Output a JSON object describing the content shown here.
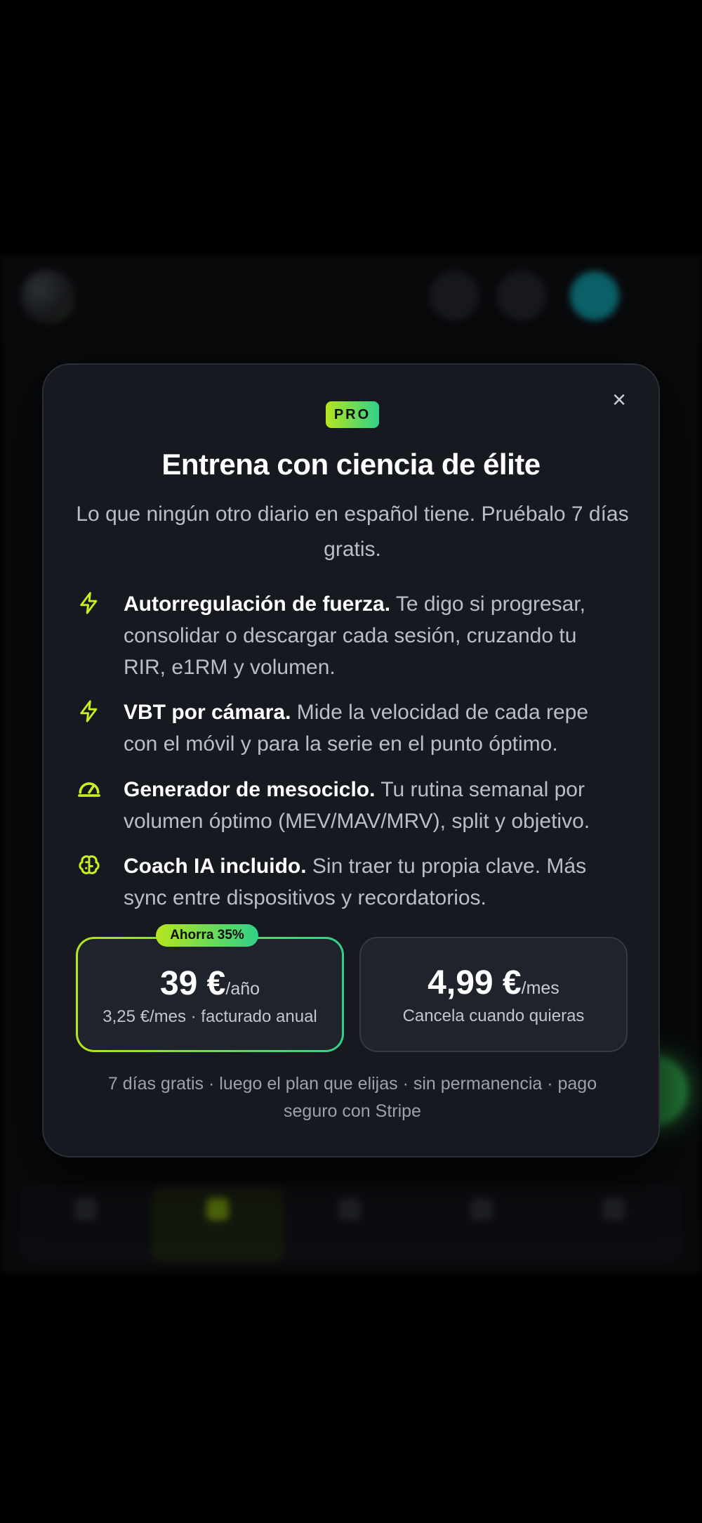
{
  "modal": {
    "badge": "PRO",
    "title": "Entrena con ciencia de élite",
    "subtitle": "Lo que ningún otro diario en español tiene. Pruébalo 7 días gratis.",
    "close_label": "×",
    "features": [
      {
        "icon": "bolt-icon",
        "title": "Autorregulación de fuerza.",
        "text": " Te digo si progresar, consolidar o descargar cada sesión, cruzando tu RIR, e1RM y volumen."
      },
      {
        "icon": "bolt-icon",
        "title": "VBT por cámara.",
        "text": " Mide la velocidad de cada repe con el móvil y para la serie en el punto óptimo."
      },
      {
        "icon": "gauge-icon",
        "title": "Generador de mesociclo.",
        "text": " Tu rutina semanal por volumen óptimo (MEV/MAV/MRV), split y objetivo."
      },
      {
        "icon": "brain-icon",
        "title": "Coach IA incluido.",
        "text": " Sin traer tu propia clave. Más sync entre dispositivos y recordatorios."
      }
    ],
    "plans": {
      "annual": {
        "badge": "Ahorra 35%",
        "price": "39 €",
        "period": "/año",
        "note": "3,25 €/mes · facturado anual"
      },
      "monthly": {
        "price": "4,99 €",
        "period": "/mes",
        "note": "Cancela cuando quieras"
      }
    },
    "footnote": "7 días gratis · luego el plan que elijas · sin permanencia · pago seguro con Stripe"
  },
  "colors": {
    "accent_start": "#b5e51d",
    "accent_end": "#2fd18a",
    "modal_bg": "#161a20",
    "icon_color": "#c6f01f"
  }
}
